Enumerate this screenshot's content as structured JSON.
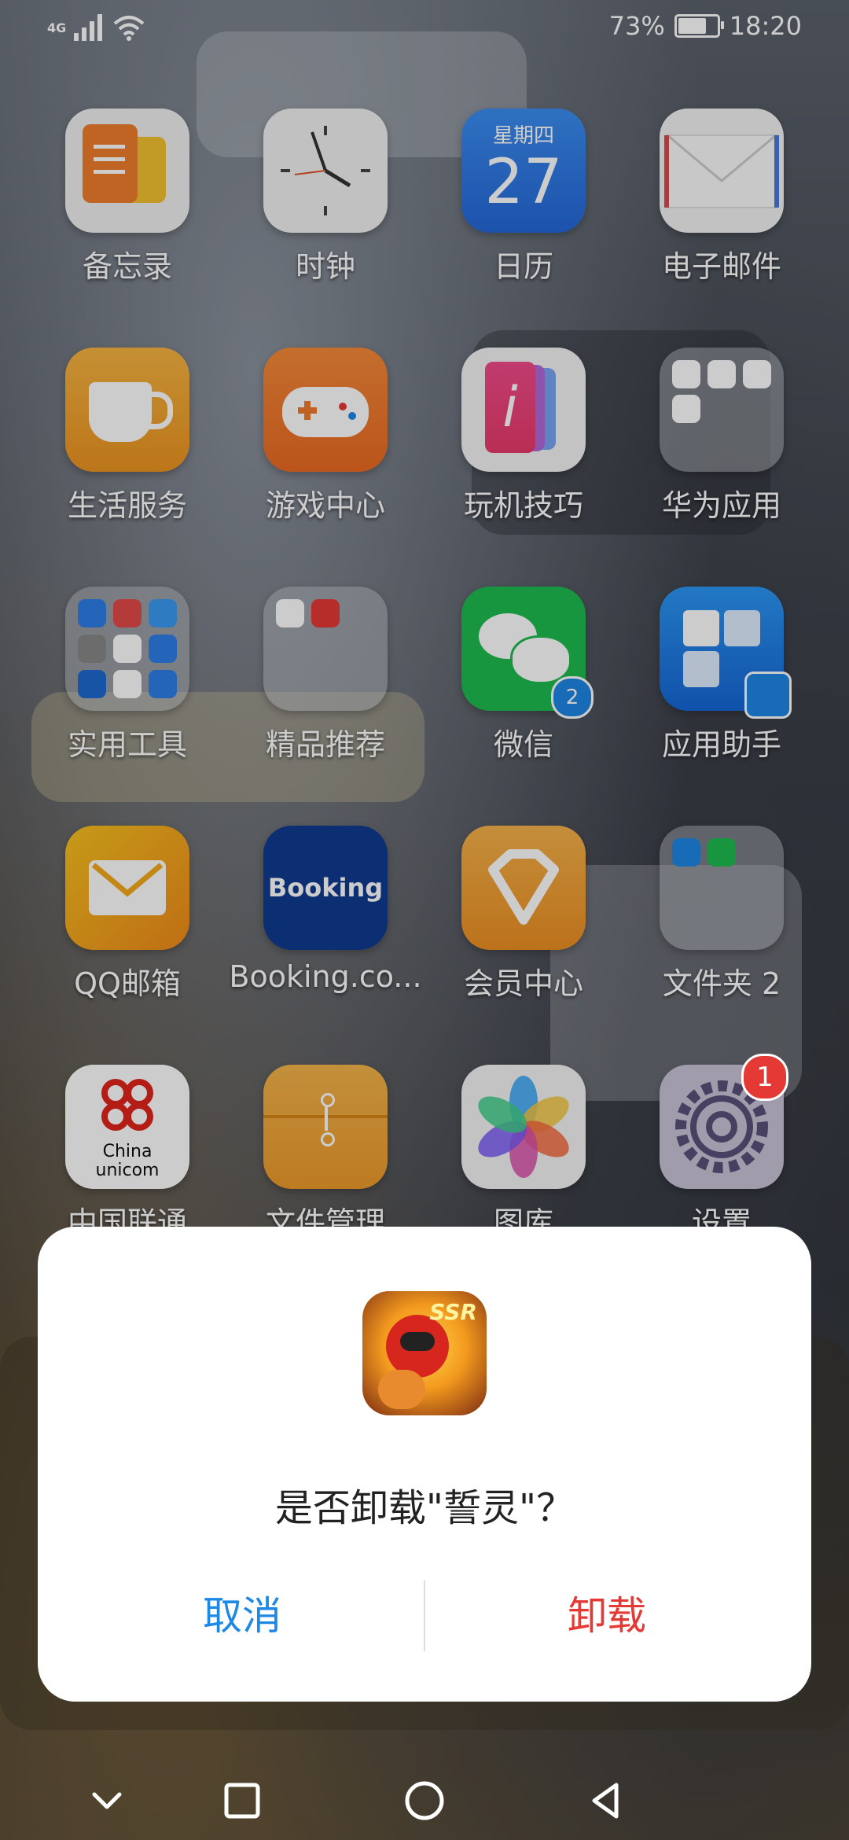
{
  "status_bar": {
    "network": "4G",
    "battery_percent": "73%",
    "battery_level": 0.73,
    "time": "18:20"
  },
  "apps": [
    {
      "label": "备忘录",
      "icon": "notes-icon",
      "bg": "#f0f0f0"
    },
    {
      "label": "时钟",
      "icon": "clock-icon",
      "bg": "#f2f2f2"
    },
    {
      "label": "日历",
      "icon": "calendar-icon",
      "bg": "#2f7fe8",
      "weekday": "星期四",
      "day": "27"
    },
    {
      "label": "电子邮件",
      "icon": "mail-icon",
      "bg": "#f3f3f3"
    },
    {
      "label": "生活服务",
      "icon": "cup-icon",
      "bg": "#f2a533"
    },
    {
      "label": "游戏中心",
      "icon": "gamepad-icon",
      "bg": "#f07b2c"
    },
    {
      "label": "玩机技巧",
      "icon": "tips-icon",
      "bg": "#f4f4f4"
    },
    {
      "label": "华为应用",
      "icon": "folder-icon",
      "bg": "folder"
    },
    {
      "label": "实用工具",
      "icon": "folder-icon",
      "bg": "folder"
    },
    {
      "label": "精品推荐",
      "icon": "folder-icon",
      "bg": "folder"
    },
    {
      "label": "微信",
      "icon": "wechat-icon",
      "bg": "#1dbb4f",
      "clone_badge": "2"
    },
    {
      "label": "应用助手",
      "icon": "puzzle-icon",
      "bg": "#1f86f0"
    },
    {
      "label": "QQ邮箱",
      "icon": "qqmail-icon",
      "bg": "#f6b51c"
    },
    {
      "label": "Booking.co...",
      "icon": "booking-icon",
      "bg": "#103a8f",
      "text": "Booking"
    },
    {
      "label": "会员中心",
      "icon": "diamond-icon",
      "bg": "#f0a338"
    },
    {
      "label": "文件夹 2",
      "icon": "folder-icon",
      "bg": "folder"
    },
    {
      "label": "中国联通",
      "icon": "unicom-icon",
      "bg": "#ffffff",
      "text_line1": "China",
      "text_line2": "unicom"
    },
    {
      "label": "文件管理",
      "icon": "files-icon",
      "bg": "#f1a83a"
    },
    {
      "label": "图库",
      "icon": "gallery-icon",
      "bg": "#f4f4f4"
    },
    {
      "label": "设置",
      "icon": "settings-icon",
      "bg": "#c8c4d8",
      "badge": "1"
    }
  ],
  "dialog": {
    "app_icon_text": "SSR",
    "title": "是否卸载\"誓灵\"？",
    "cancel_label": "取消",
    "uninstall_label": "卸载",
    "cancel_color": "#1e88e5",
    "uninstall_color": "#e53935"
  }
}
